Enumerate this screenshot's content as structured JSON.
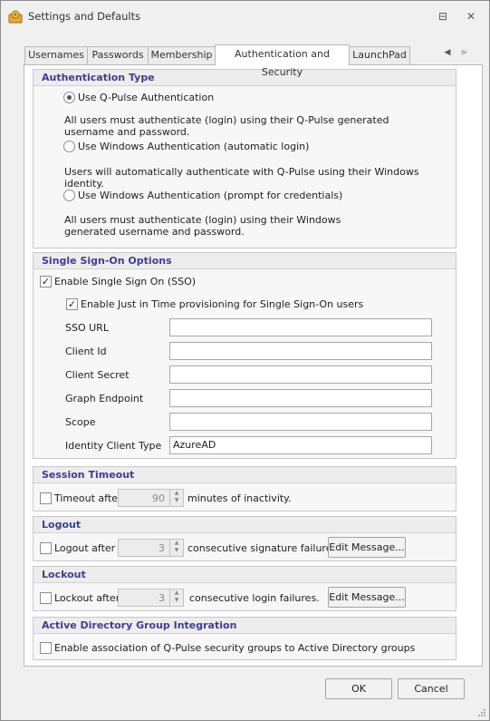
{
  "window": {
    "title": "Settings and Defaults"
  },
  "titlebar": {
    "pin_glyph": "⊟",
    "close_glyph": "✕"
  },
  "tabs": [
    "Usernames",
    "Passwords",
    "Membership",
    "Authentication and Security",
    "LaunchPad"
  ],
  "tab_arrows": {
    "left": "◀",
    "right": "▶"
  },
  "auth_type": {
    "header": "Authentication Type",
    "options": [
      {
        "label": "Use Q-Pulse Authentication",
        "selected": true,
        "desc": "All users must authenticate (login) using their Q-Pulse generated username and password."
      },
      {
        "label": "Use Windows Authentication (automatic login)",
        "selected": false,
        "desc": "Users will automatically authenticate with Q-Pulse using their Windows  identity."
      },
      {
        "label": "Use Windows Authentication (prompt for credentials)",
        "selected": false,
        "desc": "All users must authenticate (login) using their Windows generated username and password."
      }
    ]
  },
  "sso": {
    "header": "Single Sign-On Options",
    "enable_label": "Enable Single Sign On (SSO)",
    "jit_label": "Enable Just in Time provisioning for Single Sign-On users",
    "fields": [
      {
        "label": "SSO URL",
        "value": ""
      },
      {
        "label": "Client Id",
        "value": ""
      },
      {
        "label": "Client Secret",
        "value": ""
      },
      {
        "label": "Graph Endpoint",
        "value": ""
      },
      {
        "label": "Scope",
        "value": ""
      },
      {
        "label": "Identity Client Type",
        "value": "AzureAD"
      }
    ]
  },
  "session_timeout": {
    "header": "Session Timeout",
    "label": "Timeout after",
    "value": "90",
    "suffix": "minutes of inactivity."
  },
  "logout": {
    "header": "Logout",
    "label": "Logout after",
    "value": "3",
    "suffix": "consecutive signature failures.",
    "button": "Edit Message..."
  },
  "lockout": {
    "header": "Lockout",
    "label": "Lockout after",
    "value": "3",
    "suffix": "consecutive login failures.",
    "button": "Edit Message..."
  },
  "ad_group": {
    "header": "Active Directory Group Integration",
    "label": "Enable association of Q-Pulse security groups to Active Directory groups"
  },
  "footer": {
    "ok": "OK",
    "cancel": "Cancel"
  },
  "glyphs": {
    "check": "✓",
    "spin_up": "▲",
    "spin_down": "▼"
  }
}
